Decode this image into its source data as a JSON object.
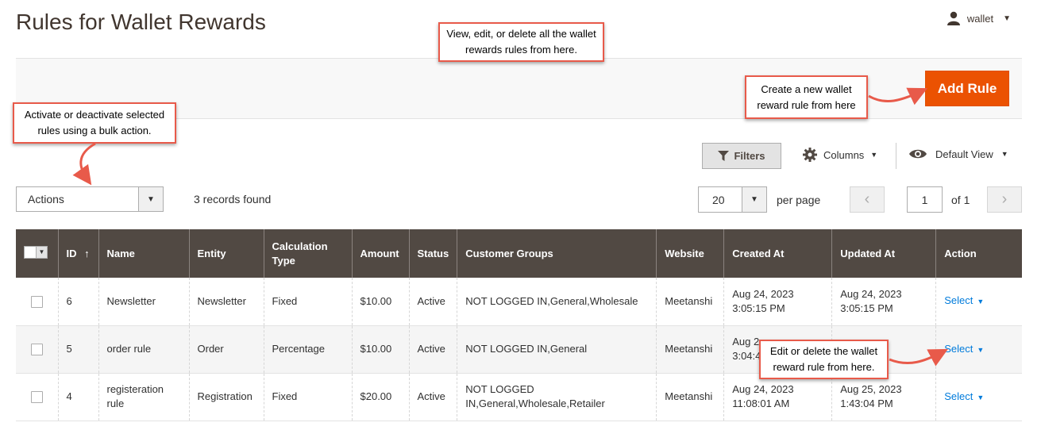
{
  "header": {
    "title": "Rules for Wallet Rewards",
    "user_name": "wallet"
  },
  "action_bar": {
    "add_rule_label": "Add Rule"
  },
  "controls": {
    "filters_label": "Filters",
    "columns_label": "Columns",
    "view_label": "Default View",
    "actions_value": "Actions",
    "records_text": "3 records found",
    "per_page_value": "20",
    "per_page_label": "per page",
    "current_page": "1",
    "of_pages": "of 1"
  },
  "table": {
    "headers": [
      "ID",
      "Name",
      "Entity",
      "Calculation Type",
      "Amount",
      "Status",
      "Customer Groups",
      "Website",
      "Created At",
      "Updated At",
      "Action"
    ],
    "rows": [
      {
        "id": "6",
        "name": "Newsletter",
        "entity": "Newsletter",
        "calc_type": "Fixed",
        "amount": "$10.00",
        "status": "Active",
        "groups": "NOT LOGGED IN,General,Wholesale",
        "website": "Meetanshi",
        "created_date": "Aug 24, 2023",
        "created_time": "3:05:15 PM",
        "updated_date": "Aug 24, 2023",
        "updated_time": "3:05:15 PM",
        "action": "Select"
      },
      {
        "id": "5",
        "name": "order rule",
        "entity": "Order",
        "calc_type": "Percentage",
        "amount": "$10.00",
        "status": "Active",
        "groups": "NOT LOGGED IN,General",
        "website": "Meetanshi",
        "created_date": "Aug 2",
        "created_time": "3:04:4",
        "updated_date": "",
        "updated_time": "",
        "action": "Select"
      },
      {
        "id": "4",
        "name": "registeration rule",
        "entity": "Registration",
        "calc_type": "Fixed",
        "amount": "$20.00",
        "status": "Active",
        "groups": "NOT LOGGED IN,General,Wholesale,Retailer",
        "website": "Meetanshi",
        "created_date": "Aug 24, 2023",
        "created_time": "11:08:01 AM",
        "updated_date": "Aug 25, 2023",
        "updated_time": "1:43:04 PM",
        "action": "Select"
      }
    ]
  },
  "callouts": {
    "top": "View, edit, or delete all the wallet rewards rules from here.",
    "add_rule": "Create a new wallet reward rule from here",
    "bulk": "Activate or deactivate selected rules using a bulk action.",
    "row_action": "Edit or delete the wallet reward rule from here."
  },
  "colors": {
    "accent": "#eb5202",
    "header_bg": "#514943",
    "link": "#007bdb",
    "callout_border": "#e85a4a"
  }
}
